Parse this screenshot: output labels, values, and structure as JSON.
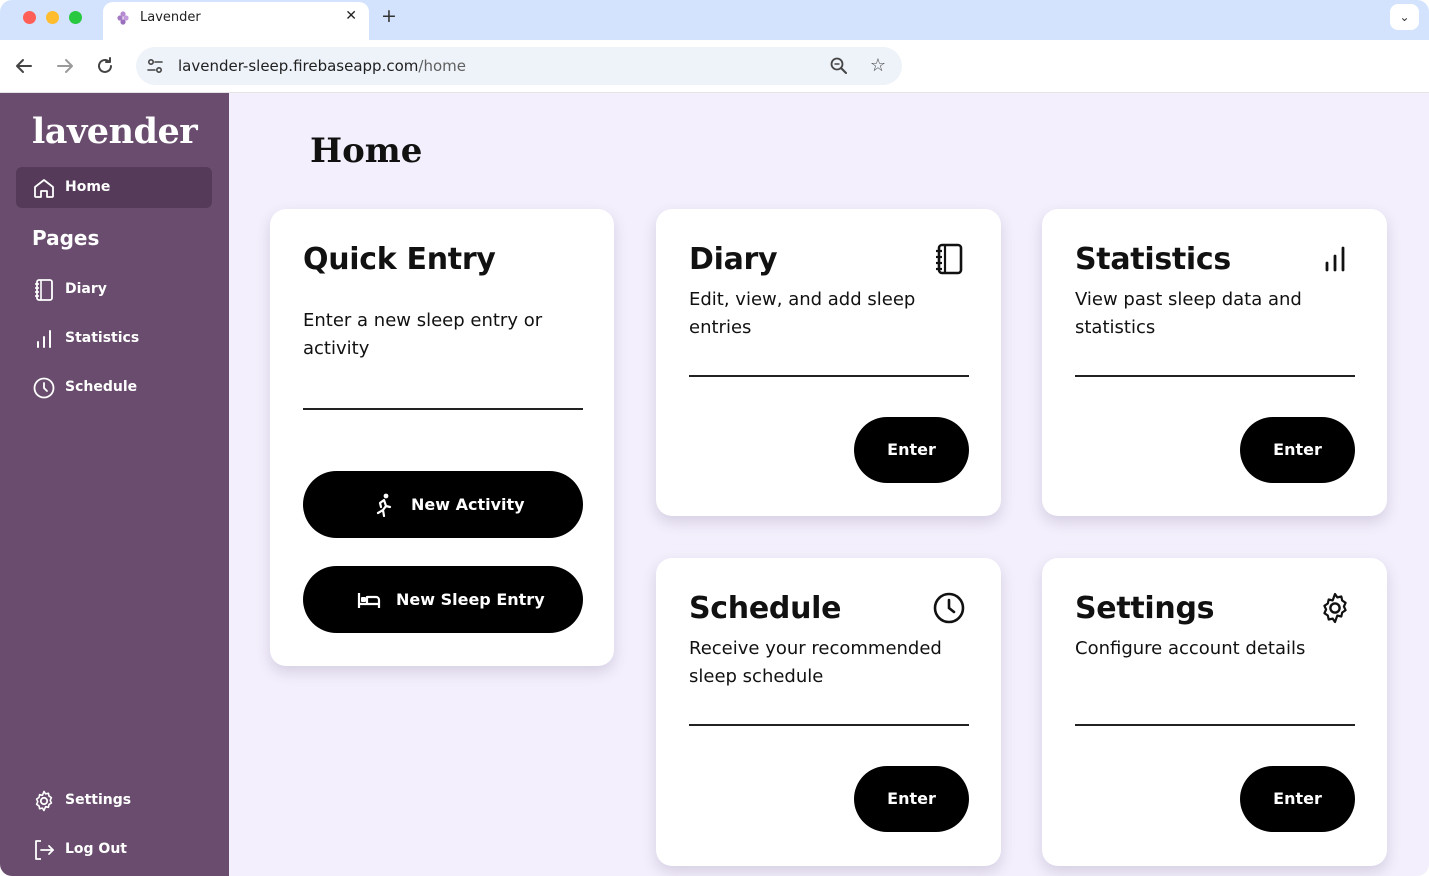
{
  "browser": {
    "tab_title": "Lavender",
    "tab_close": "✕",
    "new_tab": "+",
    "tab_menu": "⌄",
    "url_host": "lavender-sleep.firebaseapp.com",
    "url_path": "/home"
  },
  "sidebar": {
    "brand": "lavender",
    "home_label": "Home",
    "pages_heading": "Pages",
    "items": [
      {
        "label": "Diary"
      },
      {
        "label": "Statistics"
      },
      {
        "label": "Schedule"
      }
    ],
    "settings_label": "Settings",
    "logout_label": "Log Out"
  },
  "main": {
    "title": "Home",
    "quick_entry": {
      "title": "Quick Entry",
      "description": "Enter a new sleep entry or activity",
      "new_activity": "New Activity",
      "new_sleep_entry": "New Sleep Entry"
    },
    "cards": [
      {
        "title": "Diary",
        "description": "Edit, view, and add sleep entries",
        "button": "Enter"
      },
      {
        "title": "Statistics",
        "description": "View past sleep data and statistics",
        "button": "Enter"
      },
      {
        "title": "Schedule",
        "description": "Receive your recommended sleep schedule",
        "button": "Enter"
      },
      {
        "title": "Settings",
        "description": "Configure account details",
        "button": "Enter"
      }
    ]
  },
  "colors": {
    "sidebar_bg": "#6a4d6e",
    "sidebar_active": "#553b59",
    "main_bg": "#f3effc",
    "button_bg": "#000000"
  }
}
